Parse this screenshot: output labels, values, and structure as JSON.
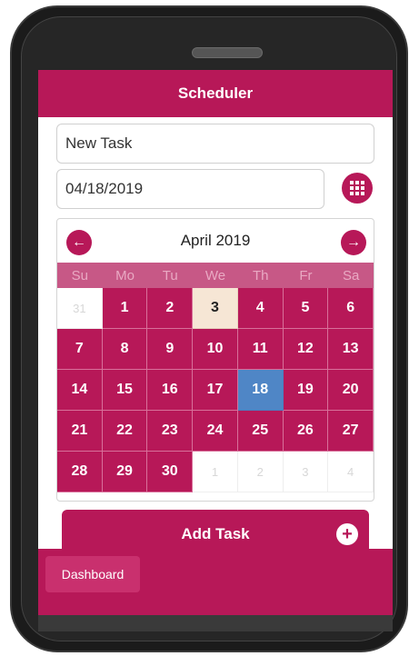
{
  "app": {
    "title": "Scheduler"
  },
  "task_input": {
    "placeholder": "New Task"
  },
  "date_input": {
    "value": "04/18/2019"
  },
  "calendar": {
    "month_label": "April 2019",
    "weekdays": [
      "Su",
      "Mo",
      "Tu",
      "We",
      "Th",
      "Fr",
      "Sa"
    ],
    "weeks": [
      [
        "31",
        "1",
        "2",
        "3",
        "4",
        "5",
        "6"
      ],
      [
        "7",
        "8",
        "9",
        "10",
        "11",
        "12",
        "13"
      ],
      [
        "14",
        "15",
        "16",
        "17",
        "18",
        "19",
        "20"
      ],
      [
        "21",
        "22",
        "23",
        "24",
        "25",
        "26",
        "27"
      ],
      [
        "28",
        "29",
        "30",
        "1",
        "2",
        "3",
        "4"
      ]
    ],
    "today": "3",
    "selected": "18"
  },
  "actions": {
    "add_task": "Add Task"
  },
  "footer": {
    "dashboard": "Dashboard"
  },
  "icons": {
    "grid": "grid-icon",
    "prev": "arrow-left-icon",
    "next": "arrow-right-icon",
    "add": "plus-icon"
  },
  "colors": {
    "primary": "#b71858",
    "selected": "#4f86c6",
    "today": "#f6e6d5"
  }
}
